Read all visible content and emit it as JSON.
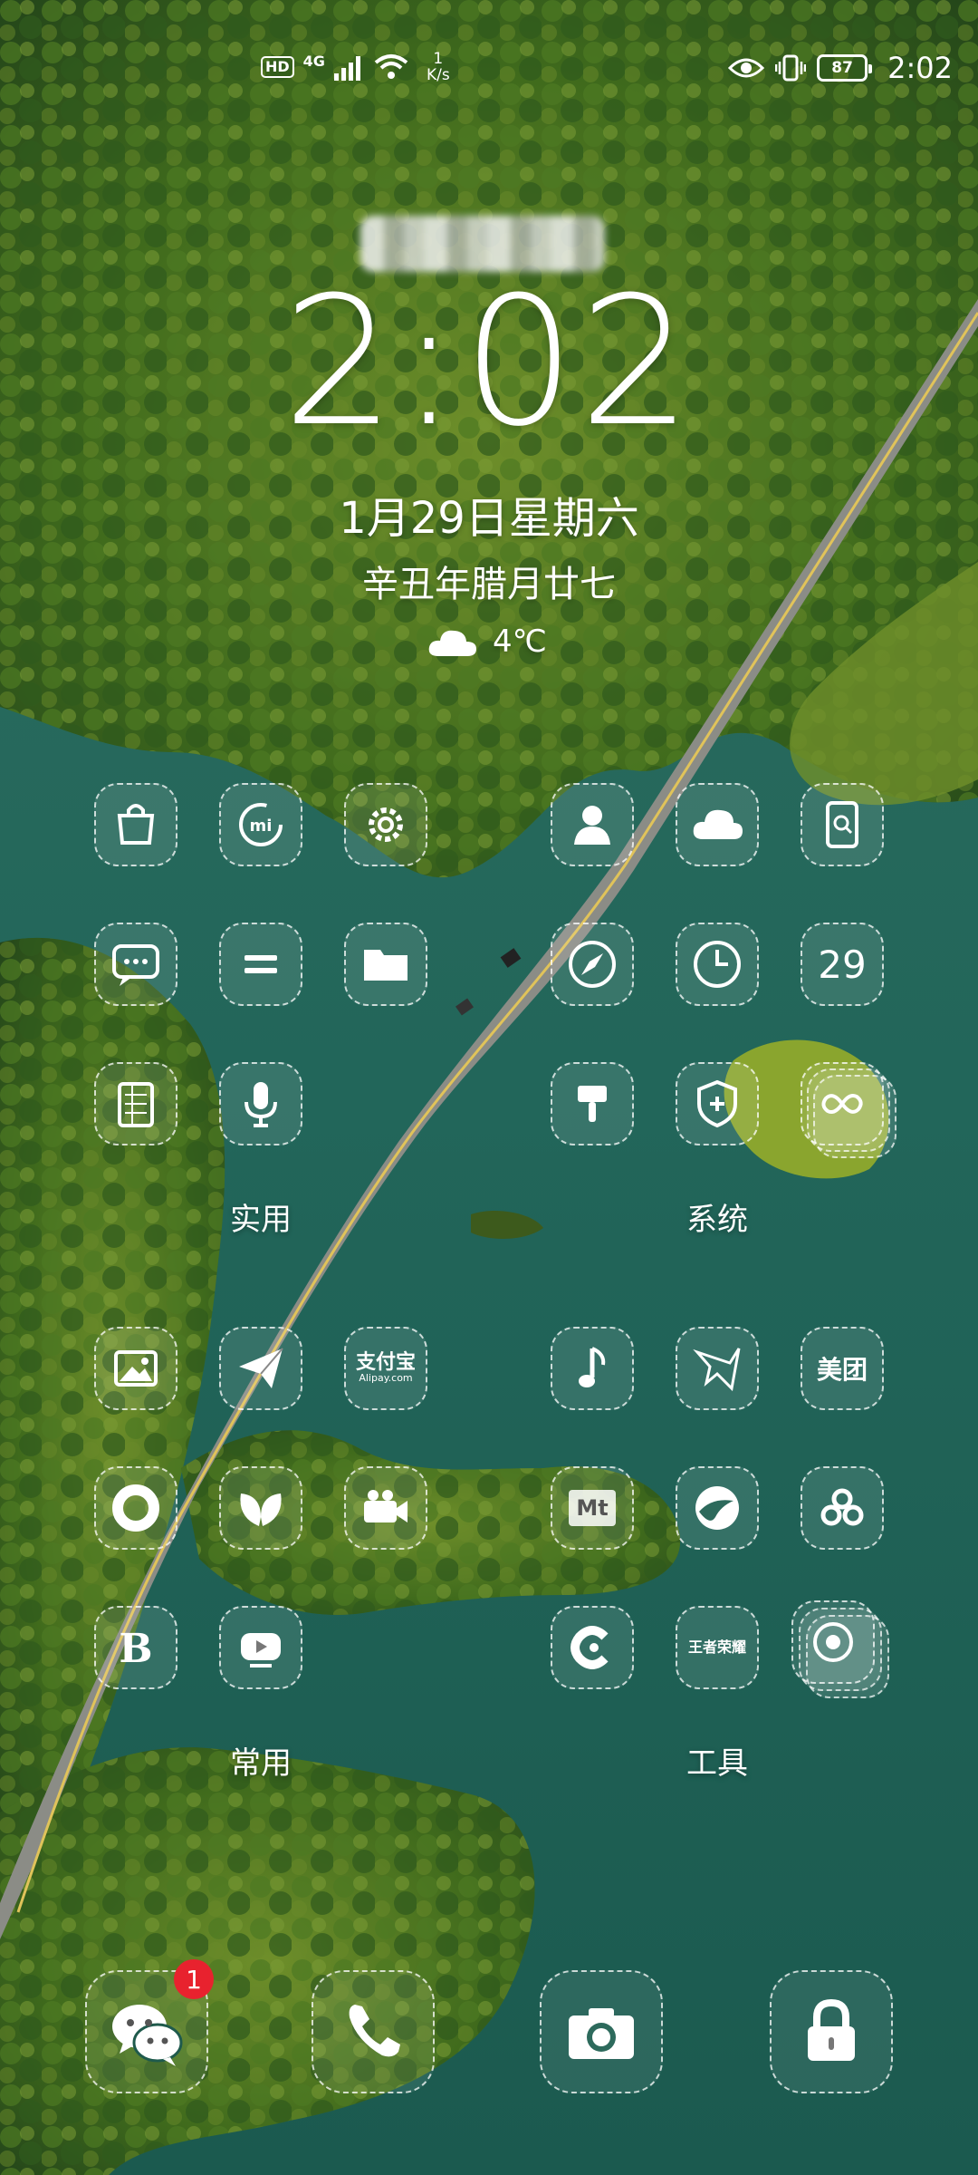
{
  "status_bar": {
    "hd": "HD",
    "network": "4G",
    "speed_value": "1",
    "speed_unit": "K/s",
    "battery": "87",
    "time": "2:02"
  },
  "lockscreen": {
    "clock": "2:02",
    "date": "1月29日星期六",
    "lunar": "辛丑年腊月廿七",
    "temperature": "4℃"
  },
  "folders": [
    {
      "label": "实用"
    },
    {
      "label": "系统"
    },
    {
      "label": "常用"
    },
    {
      "label": "工具"
    }
  ],
  "text_icons": {
    "calendar_day": "29",
    "alipay_cn": "支付宝",
    "alipay_en": "Alipay.com",
    "meituan": "美团",
    "meitu": "Mt",
    "game": "王者荣耀"
  },
  "dock": {
    "wechat_badge": "1"
  }
}
